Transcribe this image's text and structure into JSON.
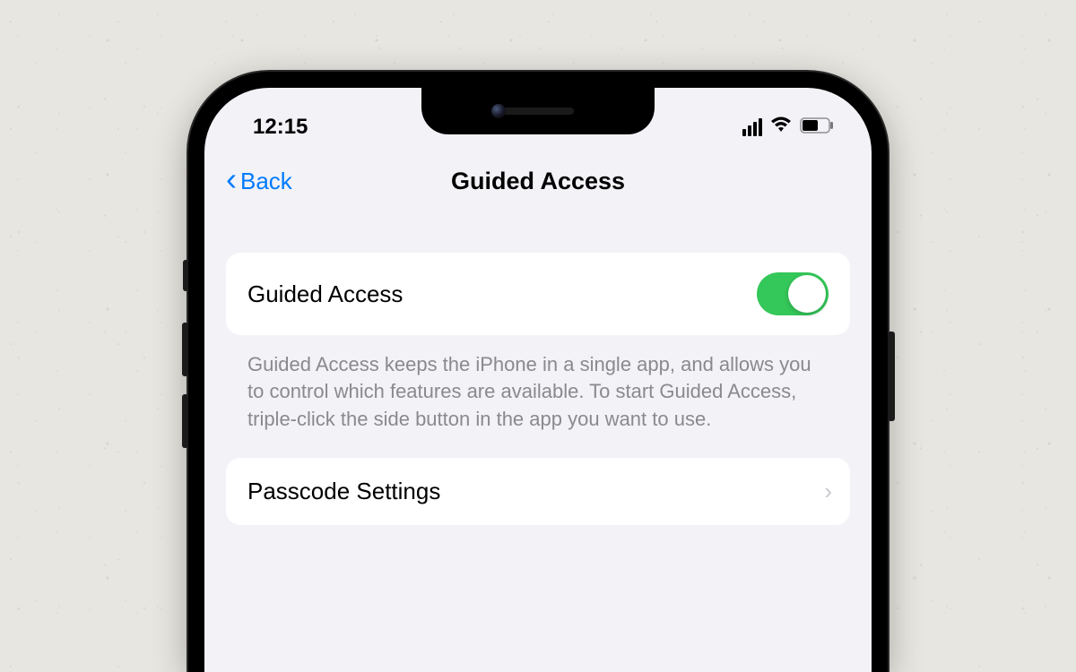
{
  "status_bar": {
    "time": "12:15",
    "cellular_icon": "cellular-signal",
    "wifi_icon": "wifi",
    "battery_icon": "battery",
    "battery_level": "~55%"
  },
  "nav": {
    "back_label": "Back",
    "title": "Guided Access"
  },
  "main_toggle": {
    "label": "Guided Access",
    "enabled": true,
    "color_on": "#34c759"
  },
  "description": "Guided Access keeps the iPhone in a single app, and allows you to control which features are available. To start Guided Access, triple-click the side button in the app you want to use.",
  "passcode_row": {
    "label": "Passcode Settings"
  }
}
